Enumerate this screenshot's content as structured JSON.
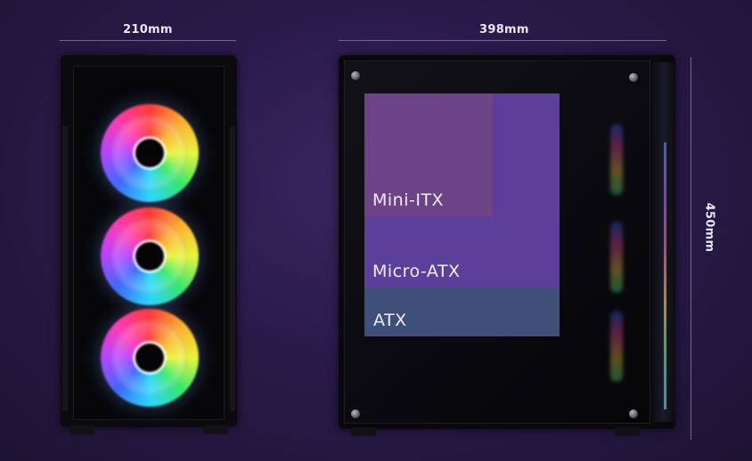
{
  "dimensions": {
    "width": "210mm",
    "length": "398mm",
    "height": "450mm"
  },
  "motherboard_support": {
    "mini_itx": "Mini-ITX",
    "micro_atx": "Micro-ATX",
    "atx": "ATX"
  },
  "colors": {
    "background": "#2a1a4a",
    "mini_itx_box": "#6c4387",
    "micro_atx_box": "#5b3f9a",
    "atx_box": "#3f4f7a"
  },
  "icons": [
    "rgb-fan-icon",
    "screw-icon"
  ]
}
